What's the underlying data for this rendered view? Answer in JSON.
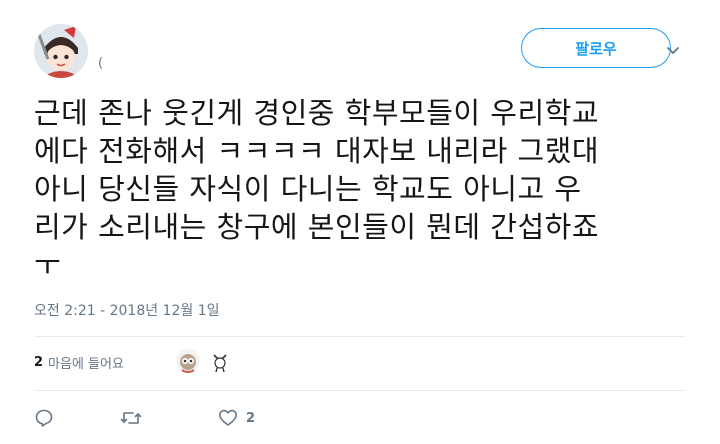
{
  "user": {
    "handle": "(",
    "avatar_icon": "profile-avatar-icon"
  },
  "follow_button": {
    "label": "팔로우"
  },
  "tweet": {
    "text": "근데 존나 웃긴게 경인중 학부모들이 우리학교\n에다 전화해서 ㅋㅋㅋㅋ 대자보 내리라 그랬대\n아니 당신들 자식이 다니는 학교도 아니고 우\n리가 소리내는 창구에 본인들이 뭔데 간섭하죠\nㅜ",
    "timestamp": "오전 2:21 - 2018년 12월 1일"
  },
  "likes": {
    "count": "2",
    "label": "마음에 들어요",
    "likers": [
      "liker-avatar-1",
      "liker-avatar-2"
    ]
  },
  "actions": {
    "reply_icon": "reply-icon",
    "retweet_icon": "retweet-icon",
    "like_icon": "heart-icon",
    "like_count": "2"
  },
  "colors": {
    "accent": "#1da1f2",
    "secondary_text": "#657786",
    "divider": "#e6ecf0"
  }
}
